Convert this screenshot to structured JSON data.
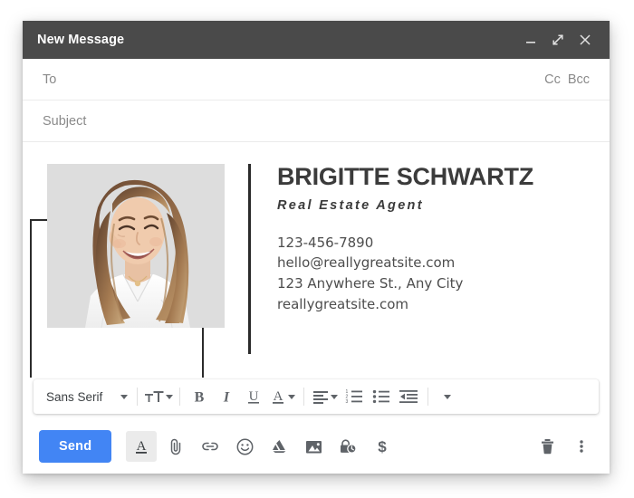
{
  "window": {
    "title": "New Message",
    "controls": [
      {
        "name": "minimize",
        "label": "Minimize"
      },
      {
        "name": "expand",
        "label": "Full screen"
      },
      {
        "name": "close",
        "label": "Save & close"
      }
    ]
  },
  "fields": {
    "to": {
      "placeholder": "To",
      "value": ""
    },
    "cc": "Cc",
    "bcc": "Bcc",
    "subject": {
      "placeholder": "Subject",
      "value": ""
    }
  },
  "signature": {
    "name": "BRIGITTE SCHWARTZ",
    "role": "Real Estate Agent",
    "contact": [
      "123-456-7890",
      "hello@reallygreatsite.com",
      "123 Anywhere St., Any City",
      "reallygreatsite.com"
    ],
    "photo_alt": "Portrait of smiling woman with long hair in white blouse"
  },
  "format_toolbar": {
    "font_family": "Sans Serif",
    "items": [
      {
        "name": "font-family-select",
        "label": "Sans Serif"
      },
      {
        "name": "font-size-button",
        "label": "Size"
      },
      {
        "name": "bold-button",
        "label": "B"
      },
      {
        "name": "italic-button",
        "label": "I"
      },
      {
        "name": "underline-button",
        "label": "U"
      },
      {
        "name": "text-color-button",
        "label": "A"
      },
      {
        "name": "align-button",
        "label": "Align"
      },
      {
        "name": "numbered-list-button",
        "label": "Numbered list"
      },
      {
        "name": "bulleted-list-button",
        "label": "Bulleted list"
      },
      {
        "name": "indent-less-button",
        "label": "Indent less"
      },
      {
        "name": "more-format-options-button",
        "label": "More options"
      }
    ]
  },
  "action_bar": {
    "send_label": "Send",
    "icons": [
      {
        "name": "format-options-icon",
        "label": "Formatting options"
      },
      {
        "name": "attach-file-icon",
        "label": "Attach files"
      },
      {
        "name": "insert-link-icon",
        "label": "Insert link"
      },
      {
        "name": "insert-emoji-icon",
        "label": "Insert emoji"
      },
      {
        "name": "google-drive-icon",
        "label": "Insert files using Drive"
      },
      {
        "name": "insert-photo-icon",
        "label": "Insert photo"
      },
      {
        "name": "confidential-mode-icon",
        "label": "Toggle confidential mode"
      },
      {
        "name": "insert-money-icon",
        "label": "Insert money"
      },
      {
        "name": "discard-draft-icon",
        "label": "Discard draft"
      },
      {
        "name": "more-options-icon",
        "label": "More options"
      }
    ]
  },
  "colors": {
    "titlebar": "#4a4a4a",
    "send_blue": "#4285f4",
    "icon_gray": "#5f6368",
    "accent_black": "#2b2b2b"
  }
}
